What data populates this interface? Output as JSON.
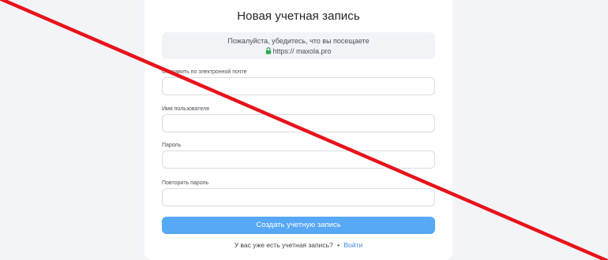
{
  "form": {
    "title": "Новая учетная запись",
    "notice": {
      "line1": "Пожалуйста, убедитесь, что вы посещаете",
      "url": "https:// maxola.pro"
    },
    "fields": [
      {
        "label": "Отправить по электронной почте",
        "value": ""
      },
      {
        "label": "Имя пользователя",
        "value": ""
      },
      {
        "label": "Пароль",
        "value": ""
      },
      {
        "label": "Повторить пароль",
        "value": ""
      }
    ],
    "submit_label": "Создать учетную запись",
    "signin": {
      "prompt": "У вас уже есть учетная запись?",
      "separator": "•",
      "link_label": "Войти"
    }
  },
  "colors": {
    "background": "#f3f4f8",
    "card": "#ffffff",
    "button": "#57a8f5",
    "link": "#3a86d8",
    "lock": "#2fa84f",
    "strike": "#e8131b"
  },
  "icons": {
    "lock": "lock-icon"
  }
}
